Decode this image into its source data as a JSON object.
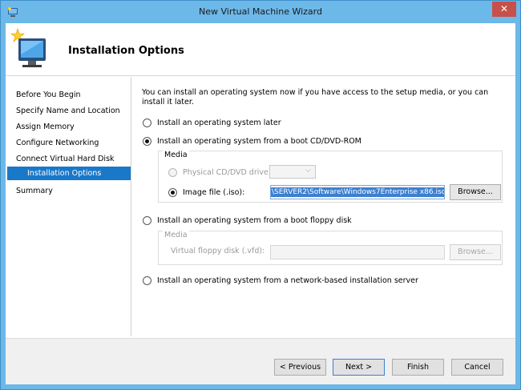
{
  "window": {
    "title": "New Virtual Machine Wizard",
    "close_glyph": "✕",
    "icon": "hyper-v-icon"
  },
  "header": {
    "title": "Installation Options",
    "icon": "computer-star-icon"
  },
  "nav": {
    "items": [
      {
        "label": "Before You Begin",
        "selected": false
      },
      {
        "label": "Specify Name and Location",
        "selected": false
      },
      {
        "label": "Assign Memory",
        "selected": false
      },
      {
        "label": "Configure Networking",
        "selected": false
      },
      {
        "label": "Connect Virtual Hard Disk",
        "selected": false
      },
      {
        "label": "Installation Options",
        "selected": true
      },
      {
        "label": "Summary",
        "selected": false
      }
    ]
  },
  "content": {
    "intro": "You can install an operating system now if you have access to the setup media, or you can install it later.",
    "options": [
      {
        "label": "Install an operating system later",
        "checked": false
      },
      {
        "label": "Install an operating system from a boot CD/DVD-ROM",
        "checked": true
      },
      {
        "label": "Install an operating system from a boot floppy disk",
        "checked": false
      },
      {
        "label": "Install an operating system from a network-based installation server",
        "checked": false
      }
    ],
    "cd_media": {
      "group_label": "Media",
      "physical_label": "Physical CD/DVD drive:",
      "physical_value": "",
      "image_label": "Image file (.iso):",
      "image_value": "\\SERVER2\\Software\\Windows7Enterprise x86.iso",
      "browse_label": "Browse..."
    },
    "floppy_media": {
      "group_label": "Media",
      "vfd_label": "Virtual floppy disk (.vfd):",
      "vfd_value": "",
      "browse_label": "Browse..."
    }
  },
  "footer": {
    "previous_label": "< Previous",
    "next_label": "Next >",
    "finish_label": "Finish",
    "cancel_label": "Cancel"
  },
  "colors": {
    "accent": "#1a78c8",
    "frame": "#6cb8e8",
    "close": "#c7504a"
  }
}
